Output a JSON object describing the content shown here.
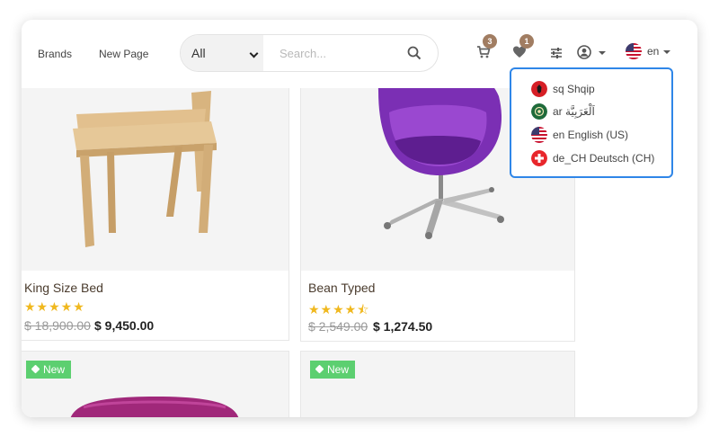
{
  "nav": {
    "brands": "Brands",
    "new_page": "New Page"
  },
  "search": {
    "category": "All",
    "placeholder": "Search..."
  },
  "header": {
    "cart_count": "3",
    "wishlist_count": "1",
    "language_code": "en"
  },
  "products": [
    {
      "name": "King Size Bed",
      "rating": "★★★★★",
      "old_price": "$ 18,900.00",
      "price": "$ 9,450.00"
    },
    {
      "name": "Bean Typed",
      "rating": "★★★★⯪",
      "old_price": "$ 2,549.00",
      "price": "$ 1,274.50"
    },
    {
      "tag": "New"
    },
    {
      "tag": "New"
    }
  ],
  "languages": [
    {
      "label": "sq Shqip",
      "flag": "albania-flag"
    },
    {
      "label": "ar اَلْعَرَبِيَّة",
      "flag": "arabic-flag"
    },
    {
      "label": "en English (US)",
      "flag": "usa-flag"
    },
    {
      "label": "de_CH Deutsch (CH)",
      "flag": "switzerland-flag"
    }
  ],
  "colors": {
    "accent": "#a17d62",
    "tag_green": "#5ccf70",
    "star": "#f0b81e",
    "dropdown_border": "#2f86e8"
  }
}
